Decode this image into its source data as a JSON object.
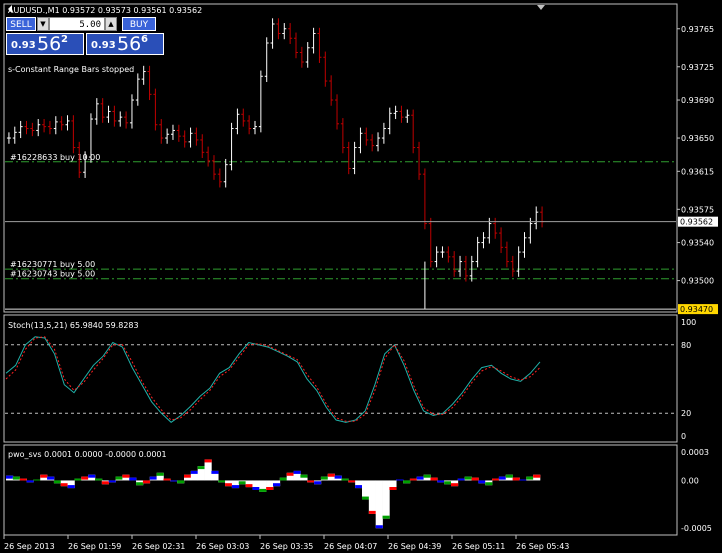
{
  "header": {
    "symbol_text": "AUDUSD.,M1  0.93572 0.93573 0.93561 0.93562"
  },
  "trade_panel": {
    "sell_label": "SELL",
    "buy_label": "BUY",
    "volume": "5.00",
    "bid_small": "0.93",
    "bid_big": "56",
    "bid_sup": "2",
    "ask_small": "0.93",
    "ask_big": "56",
    "ask_sup": "6"
  },
  "status_text": "s-Constant Range Bars stopped",
  "orders": [
    {
      "label": "#16228633 buy 10.00",
      "price": 0.93625
    },
    {
      "label": "#16230771 buy 5.00",
      "price": 0.93512
    },
    {
      "label": "#16230743 buy 5.00",
      "price": 0.93502
    }
  ],
  "indicators": {
    "stoch_label": "Stoch(13,5,21) 65.9840 59.8283",
    "pwo_label": "pwo_svs 0.0001 0.0000 -0.0000 0.0001"
  },
  "colors": {
    "background": "#000000",
    "grid": "#c0c0c0",
    "bull_bar": "#ffffff",
    "bear_bar": "#c00000",
    "order_line": "#2f9e2f",
    "stoch_main": "#20b2aa",
    "stoch_signal": "#ff2020",
    "hist_white": "#ffffff",
    "hist_blue": "#0000ff",
    "hist_green": "#00a000",
    "hist_red": "#ff0000",
    "price_marker_bg": "#ffffff",
    "low_marker_bg": "#ffd700"
  },
  "chart_data": [
    {
      "type": "line",
      "title": "AUDUSD.,M1",
      "series": [
        {
          "values": [
            0.9365,
            0.93656,
            0.93662,
            0.9366,
            0.93658,
            0.93664,
            0.93662,
            0.9366,
            0.93667,
            0.93664,
            0.93668,
            0.9364,
            0.93614,
            0.9363,
            0.9367,
            0.93686,
            0.93672,
            0.93678,
            0.93668,
            0.93672,
            0.93666,
            0.9369,
            0.93712,
            0.9372,
            0.93696,
            0.93664,
            0.9365,
            0.93654,
            0.93658,
            0.93652,
            0.93646,
            0.93655,
            0.93648,
            0.93635,
            0.93626,
            0.93612,
            0.93604,
            0.93622,
            0.9366,
            0.93675,
            0.93668,
            0.9366,
            0.93662,
            0.93715,
            0.9375,
            0.9377,
            0.9376,
            0.93765,
            0.93755,
            0.9374,
            0.9373,
            0.93745,
            0.9376,
            0.93735,
            0.9371,
            0.9369,
            0.93665,
            0.9364,
            0.93618,
            0.9364,
            0.93655,
            0.93648,
            0.93642,
            0.9365,
            0.9366,
            0.93676,
            0.93678,
            0.93672,
            0.93674,
            0.9364,
            0.93612,
            0.9356,
            0.9352,
            0.9353,
            0.9353,
            0.93525,
            0.9351,
            0.9352,
            0.93505,
            0.9352,
            0.9354,
            0.93545,
            0.9356,
            0.9355,
            0.93535,
            0.9352,
            0.9351,
            0.9353,
            0.93545,
            0.9356,
            0.93572,
            0.93562
          ],
          "low": 0.9347,
          "last": 0.93562
        }
      ],
      "x": [
        "26 Sep 2013",
        "26 Sep 01:59",
        "26 Sep 02:31",
        "26 Sep 03:03",
        "26 Sep 03:35",
        "26 Sep 04:07",
        "26 Sep 04:39",
        "26 Sep 05:11",
        "26 Sep 05:43"
      ],
      "y_ticks": [
        "0.93765",
        "0.93725",
        "0.93690",
        "0.93650",
        "0.93615",
        "0.93575",
        "0.93540",
        "0.93500"
      ],
      "current_price_label": "0.93562",
      "low_price_label": "0.93470",
      "ylim": [
        0.93468,
        0.9379
      ]
    },
    {
      "type": "line",
      "title": "Stoch(13,5,21) 65.9840 59.8283",
      "y_ticks": [
        "100",
        "80",
        "20",
        "0"
      ],
      "levels": [
        80,
        20
      ],
      "ylim": [
        0,
        100
      ],
      "series": [
        {
          "values": [
            55,
            62,
            80,
            87,
            86,
            72,
            45,
            38,
            50,
            62,
            70,
            82,
            78,
            60,
            45,
            30,
            20,
            12,
            18,
            26,
            35,
            42,
            55,
            60,
            72,
            82,
            80,
            78,
            74,
            70,
            65,
            50,
            40,
            25,
            14,
            12,
            14,
            22,
            45,
            72,
            80,
            62,
            40,
            22,
            18,
            20,
            28,
            38,
            50,
            60,
            62,
            55,
            50,
            48,
            55,
            65
          ]
        },
        {
          "values": [
            50,
            58,
            76,
            86,
            87,
            76,
            50,
            40,
            47,
            58,
            68,
            80,
            80,
            65,
            48,
            34,
            23,
            14,
            16,
            23,
            32,
            40,
            52,
            58,
            69,
            80,
            81,
            79,
            75,
            71,
            67,
            54,
            43,
            28,
            16,
            13,
            13,
            19,
            40,
            68,
            80,
            66,
            44,
            25,
            19,
            19,
            25,
            35,
            47,
            57,
            61,
            57,
            52,
            49,
            52,
            60
          ]
        }
      ]
    },
    {
      "type": "bar",
      "title": "pwo_svs 0.0001 0.0000 -0.0000 0.0001",
      "y_ticks": [
        "0.0003",
        "0.00",
        "-0.0005"
      ],
      "ylim": [
        -0.00055,
        0.00035
      ],
      "series": [
        {
          "values": [
            5e-05,
            4e-05,
            2e-05,
            -2e-05,
            1e-05,
            6e-05,
            4e-05,
            -3e-05,
            -6e-05,
            -8e-05,
            2e-05,
            4e-05,
            6e-05,
            2e-05,
            -4e-05,
            -2e-05,
            4e-05,
            6e-05,
            3e-05,
            -5e-05,
            -3e-05,
            4e-05,
            8e-05,
            2e-05,
            -1e-05,
            -3e-05,
            6e-05,
            0.0001,
            0.00015,
            0.00022,
            0.0001,
            -2e-05,
            -6e-05,
            -8e-05,
            -4e-05,
            -7e-05,
            -0.0001,
            -0.00012,
            -0.0001,
            -6e-05,
            3e-05,
            8e-05,
            0.0001,
            6e-05,
            -2e-05,
            -4e-05,
            4e-05,
            7e-05,
            5e-05,
            2e-05,
            -2e-05,
            -8e-05,
            -0.0002,
            -0.00035,
            -0.0005,
            -0.0004,
            -0.0001,
            1e-05,
            -3e-05,
            2e-05,
            4e-05,
            6e-05,
            3e-05,
            -2e-05,
            -4e-05,
            -6e-05,
            2e-05,
            4e-05,
            3e-05,
            -3e-05,
            -5e-05,
            2e-05,
            4e-05,
            6e-05,
            3e-05,
            1e-05,
            4e-05,
            6e-05
          ]
        }
      ]
    }
  ]
}
